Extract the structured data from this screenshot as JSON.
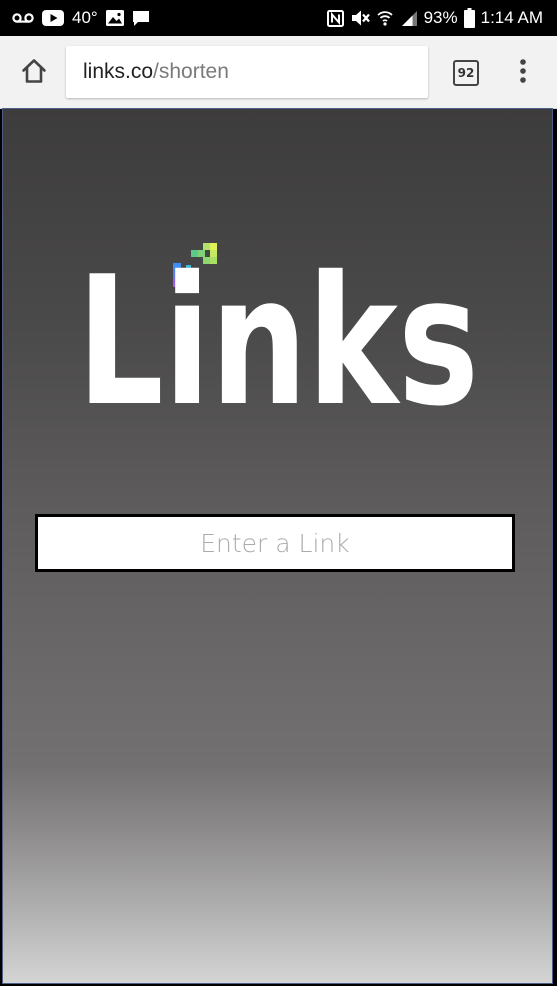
{
  "status_bar": {
    "temperature": "40°",
    "battery_percent": "93%",
    "time": "1:14 AM",
    "icons_left": [
      "voicemail-icon",
      "youtube-icon",
      "image-icon",
      "message-icon"
    ],
    "icons_right": [
      "nfc-icon",
      "mute-icon",
      "wifi-icon",
      "signal-icon",
      "battery-icon"
    ]
  },
  "browser": {
    "url_host": "links.co",
    "url_path": "/shorten",
    "tab_count": "92"
  },
  "page": {
    "logo_text": "Links",
    "link_input_placeholder": "Enter a Link",
    "link_input_value": ""
  },
  "colors": {
    "logo": "#ffffff",
    "logo_pixels": [
      "#9b5cf0",
      "#3f8df3",
      "#3ab0e6",
      "#5ec889",
      "#a6e06a",
      "#dff25c"
    ],
    "background_top": "#3d3c3c",
    "background_bottom": "#d4d4d4"
  }
}
